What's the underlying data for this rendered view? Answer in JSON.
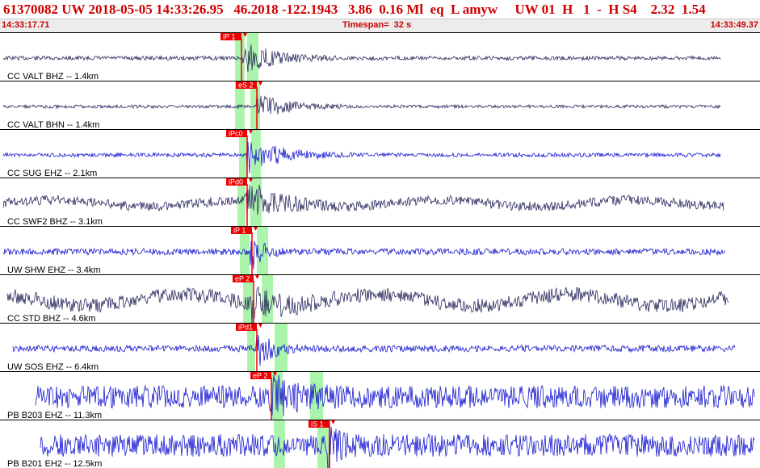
{
  "header": {
    "title": "61370082 UW 2018-05-05 14:33:26.95   46.2018 -122.1943   3.86  0.16 Ml  eq  L amyw     UW 01  H   1  -  H S4    2.32  1.54",
    "start_time": "14:33:17.71",
    "timespan": "Timespan=  32 s",
    "end_time": "14:33:49.37"
  },
  "traces": [
    {
      "label": "CC VALT BHZ -- 1.4km",
      "pick": "iP 1",
      "color": "#2a2a60"
    },
    {
      "label": "CC VALT BHN -- 1.4km",
      "pick": "eS 2",
      "color": "#2a2a60"
    },
    {
      "label": "CC SUG EHZ -- 2.1km",
      "pick": "iPc0",
      "color": "#1a1ad0"
    },
    {
      "label": "CC SWF2 BHZ -- 3.1km",
      "pick": "iPd0",
      "color": "#2a2a60"
    },
    {
      "label": "UW SHW EHZ -- 3.4km",
      "pick": "iP 1",
      "color": "#1a1ad0"
    },
    {
      "label": "CC STD BHZ -- 4.6km",
      "pick": "eP 2",
      "color": "#2a2a60"
    },
    {
      "label": "UW SOS EHZ -- 6.4km",
      "pick": "iPd1",
      "color": "#1a1ad0"
    },
    {
      "label": "PB B203 EHZ -- 11.3km",
      "pick": "eP 2",
      "color": "#1a1ad0"
    },
    {
      "label": "PB B201 EH2 -- 12.5km",
      "pick": "iS 1",
      "color": "#1a1ad0"
    }
  ],
  "colors": {
    "title": "#cc0000",
    "pick_box": "#ee0000",
    "window_band": "#9cf29c",
    "pick_line": "#ee0000"
  }
}
